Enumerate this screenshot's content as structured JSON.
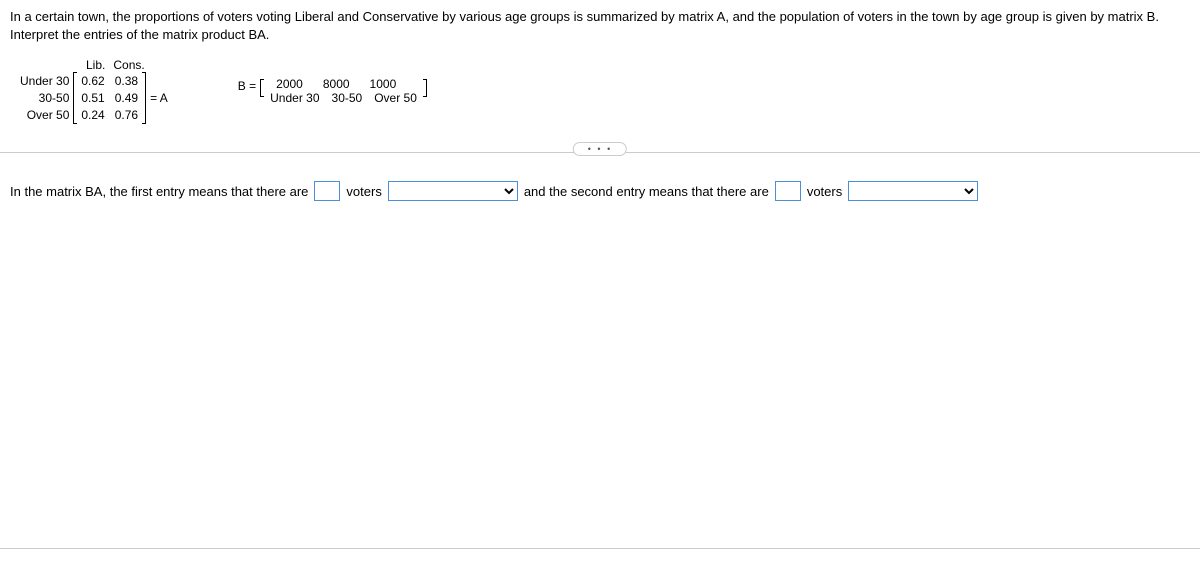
{
  "problem": "In a certain town, the proportions of voters voting Liberal and Conservative by various age groups is summarized by matrix A, and the population of voters in the town by age group is given by matrix B. Interpret the entries of the matrix product BA.",
  "matrixA": {
    "colHeaders": [
      "Lib.",
      "Cons."
    ],
    "rowLabels": [
      "Under 30",
      "30-50",
      "Over 50"
    ],
    "rows": [
      [
        "0.62",
        "0.38"
      ],
      [
        "0.51",
        "0.49"
      ],
      [
        "0.24",
        "0.76"
      ]
    ],
    "equals": "= A"
  },
  "matrixB": {
    "prefix": "B =",
    "values": [
      "2000",
      "8000",
      "1000"
    ],
    "labels": [
      "Under 30",
      "30-50",
      "Over 50"
    ]
  },
  "answerText": {
    "part1": "In the matrix BA, the first entry means that there are",
    "voters1": "voters",
    "part2": "and the second entry means that there are",
    "voters2": "voters"
  },
  "ellipsis": "• • •"
}
